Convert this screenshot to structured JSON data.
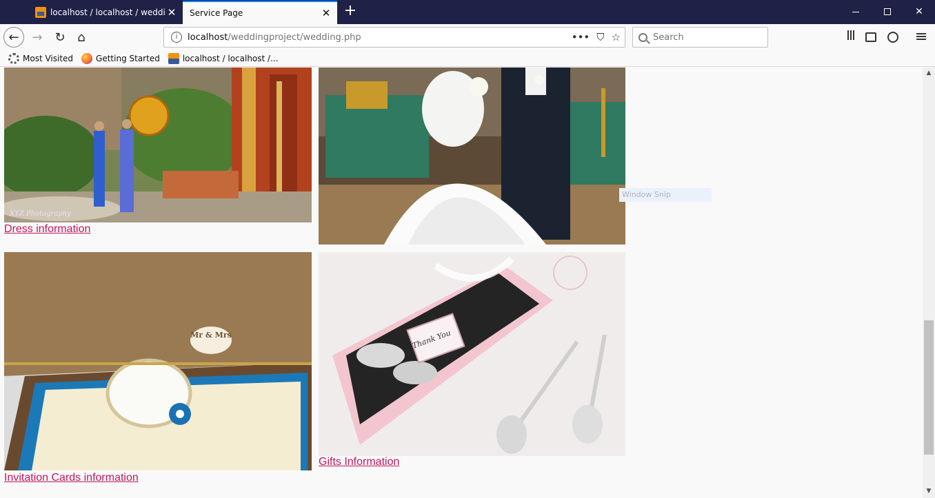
{
  "tabs": [
    {
      "title": "localhost / localhost / weddingproj",
      "close": "✕"
    },
    {
      "title": "Service Page",
      "close": "✕"
    }
  ],
  "new_tab_label": "+",
  "window_controls": {
    "close": "✕"
  },
  "nav": {
    "url_host": "localhost",
    "url_path": "/weddingproject/wedding.php",
    "url_info_glyph": "i",
    "page_actions_glyph": "•••",
    "pocket_glyph": "⛉",
    "bookmark_glyph": "☆",
    "search_placeholder": "Search",
    "back_glyph": "←",
    "forward_glyph": "→",
    "reload_glyph": "↻",
    "home_glyph": "⌂"
  },
  "bookmarks": [
    {
      "label": "Most Visited",
      "icon": "gear-icon"
    },
    {
      "label": "Getting Started",
      "icon": "firefox-icon"
    },
    {
      "label": "localhost / localhost /...",
      "icon": "phpmyadmin-icon"
    }
  ],
  "content": {
    "dress_link": "Dress information",
    "invitation_link": "Invitation Cards information",
    "gifts_link": "Gifts Information",
    "dress_watermark": "XYZ Photography",
    "gift_tag": "Thank You",
    "card_plaque": "Mr & Mrs"
  },
  "overlay": {
    "snip_tooltip": "Window Snip"
  },
  "scrollbar": {
    "position": 0.62,
    "up": "▲",
    "down": "▼"
  },
  "colors": {
    "link": "#c2185b",
    "titlebar": "#1f2147",
    "active_tab_accent": "#0a84ff"
  }
}
